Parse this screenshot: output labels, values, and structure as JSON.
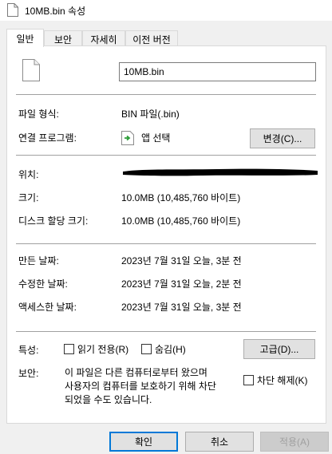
{
  "window": {
    "title": "10MB.bin 속성"
  },
  "tabs": [
    "일반",
    "보안",
    "자세히",
    "이전 버전"
  ],
  "general": {
    "file_name": "10MB.bin",
    "file_type_label": "파일 형식:",
    "file_type_value": "BIN 파일(.bin)",
    "open_with_label": "연결 프로그램:",
    "open_with_value": "앱 선택",
    "change_button": "변경(C)...",
    "location_label": "위치:",
    "size_label": "크기:",
    "size_value": "10.0MB (10,485,760 바이트)",
    "size_on_disk_label": "디스크 할당 크기:",
    "size_on_disk_value": "10.0MB (10,485,760 바이트)",
    "created_label": "만든 날짜:",
    "created_value": "2023년 7월 31일 오늘, 3분 전",
    "modified_label": "수정한 날짜:",
    "modified_value": "2023년 7월 31일 오늘, 2분 전",
    "accessed_label": "액세스한 날짜:",
    "accessed_value": "2023년 7월 31일 오늘, 3분 전",
    "attributes_label": "특성:",
    "readonly_label": "읽기 전용(R)",
    "hidden_label": "숨김(H)",
    "advanced_button": "고급(D)...",
    "security_label": "보안:",
    "security_line1": "이 파일은 다른 컴퓨터로부터 왔으며",
    "security_line2": "사용자의 컴퓨터를 보호하기 위해 차단",
    "security_line3": "되었을 수도 있습니다.",
    "unblock_label": "차단 해제(K)"
  },
  "footer": {
    "ok": "확인",
    "cancel": "취소",
    "apply": "적용(A)"
  },
  "icons": {
    "title": "file-icon",
    "app": "open-with-arrow-icon"
  },
  "colors": {
    "accent": "#0078d7",
    "separator": "#a0a0a0",
    "app_arrow": "#2e9e3a"
  }
}
